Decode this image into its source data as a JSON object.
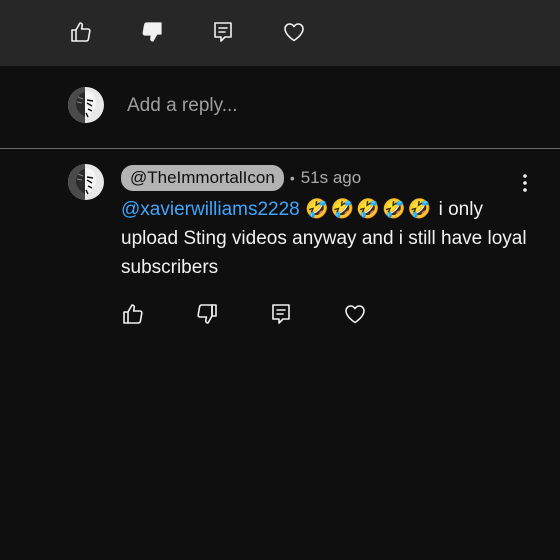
{
  "reply": {
    "placeholder": "Add a reply..."
  },
  "comment": {
    "handle": "@TheImmortalIcon",
    "separator": "•",
    "timestamp": "51s ago",
    "mention": "@xavierwilliams2228",
    "emojis": "🤣🤣🤣🤣🤣",
    "text": " i only upload Sting videos anyway and i still have loyal subscribers"
  },
  "icons": {
    "like": "thumbs-up-icon",
    "dislike": "thumbs-down-icon",
    "reply": "comment-icon",
    "heart": "heart-icon",
    "more": "kebab-menu-icon"
  },
  "colors": {
    "background": "#0f0f0f",
    "top_bar": "#272727",
    "mention": "#3ea6ff",
    "badge": "#b3b3b3",
    "muted_text": "#aaaaaa"
  }
}
